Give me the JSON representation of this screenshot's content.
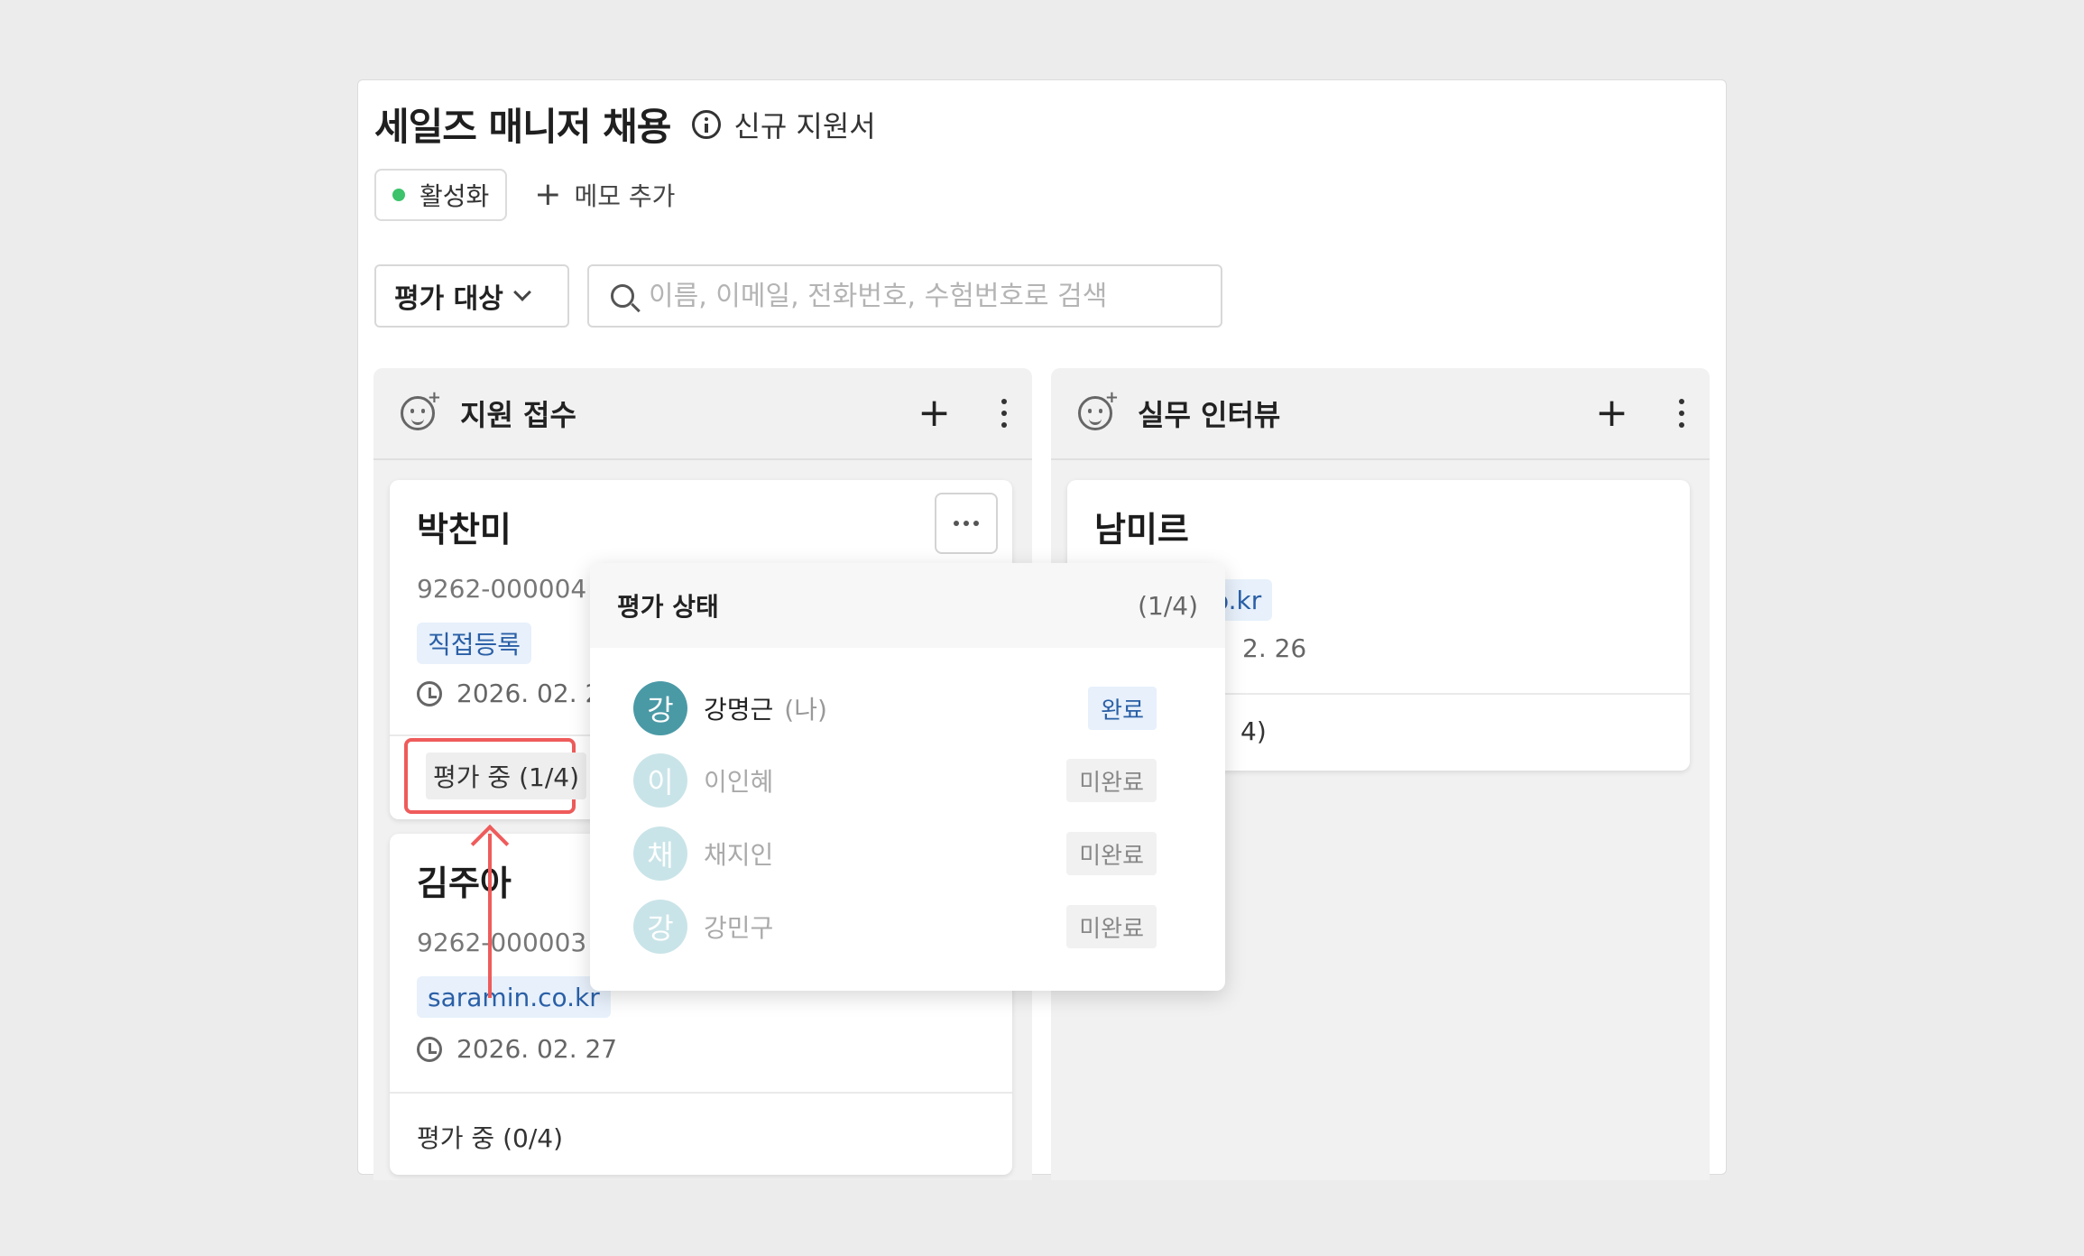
{
  "header": {
    "title": "세일즈 매니저 채용",
    "info_label": "신규 지원서",
    "status_label": "활성화",
    "memo_label": "메모 추가"
  },
  "filter": {
    "select_value": "평가 대상",
    "search_placeholder": "이름, 이메일, 전화번호, 수험번호로 검색"
  },
  "columns": [
    {
      "title": "지원 접수",
      "cards": [
        {
          "name": "박찬미",
          "id": "9262-000004",
          "tag": "직접등록",
          "date": "2026. 02. 2",
          "eval": "평가 중 (1/4)"
        },
        {
          "name": "김주아",
          "id": "9262-000003",
          "tag": "saramin.co.kr",
          "date": "2026. 02. 27",
          "eval": "평가 중 (0/4)"
        }
      ]
    },
    {
      "title": "실무 인터뷰",
      "cards": [
        {
          "name": "남미르",
          "tag": "o.kr",
          "date": "2. 26",
          "eval": "4)"
        }
      ]
    }
  ],
  "popover": {
    "title": "평가 상태",
    "count": "(1/4)",
    "evaluators": [
      {
        "initial": "강",
        "name": "강명근",
        "me": "(나)",
        "status": "완료"
      },
      {
        "initial": "이",
        "name": "이인혜",
        "status": "미완료"
      },
      {
        "initial": "채",
        "name": "채지인",
        "status": "미완료"
      },
      {
        "initial": "강",
        "name": "강민구",
        "status": "미완료"
      }
    ]
  },
  "colors": {
    "active_dot": "#3cc36b",
    "highlight": "#ef5b5b",
    "tag_text": "#2a5fa6",
    "avatar_done": "#4a9aa6",
    "avatar_pending": "#c9e4e8"
  }
}
